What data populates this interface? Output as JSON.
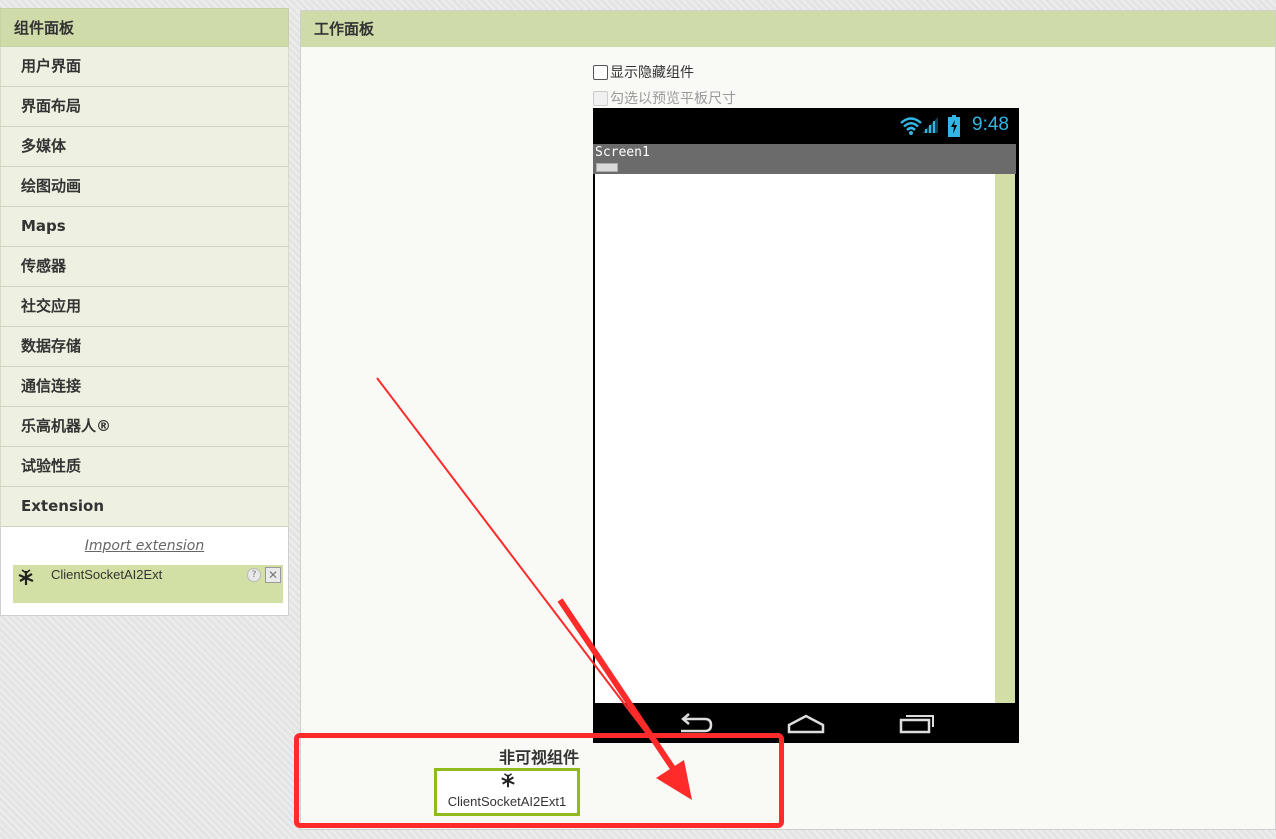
{
  "palette": {
    "title": "组件面板",
    "categories": [
      "用户界面",
      "界面布局",
      "多媒体",
      "绘图动画",
      "Maps",
      "传感器",
      "社交应用",
      "数据存储",
      "通信连接",
      "乐高机器人®",
      "试验性质",
      "Extension"
    ],
    "extension": {
      "import_link": "Import extension",
      "component_name": "ClientSocketAI2Ext",
      "help": "?",
      "delete": "✕",
      "icon": "extension-icon"
    }
  },
  "workspace": {
    "title": "工作面板",
    "show_hidden_label": "显示隐藏组件",
    "tablet_preview_label": "勾选以预览平板尺寸"
  },
  "phone": {
    "time": "9:48",
    "screen_title": "Screen1",
    "icons": [
      "wifi-icon",
      "signal-icon",
      "battery-icon",
      "back-icon",
      "home-icon",
      "recent-apps-icon"
    ],
    "colors": {
      "time": "#33b5e5",
      "titlebar": "#6b6b6b"
    }
  },
  "nonvisible": {
    "label": "非可视组件",
    "component_name": "ClientSocketAI2Ext1",
    "colors": {
      "highlight": "#ff2a2a",
      "selected": "#8fbc1c"
    }
  },
  "colors": {
    "header": "#cfdcaa",
    "category_bg": "#eef1e1",
    "annotation": "#ff2a2a"
  }
}
